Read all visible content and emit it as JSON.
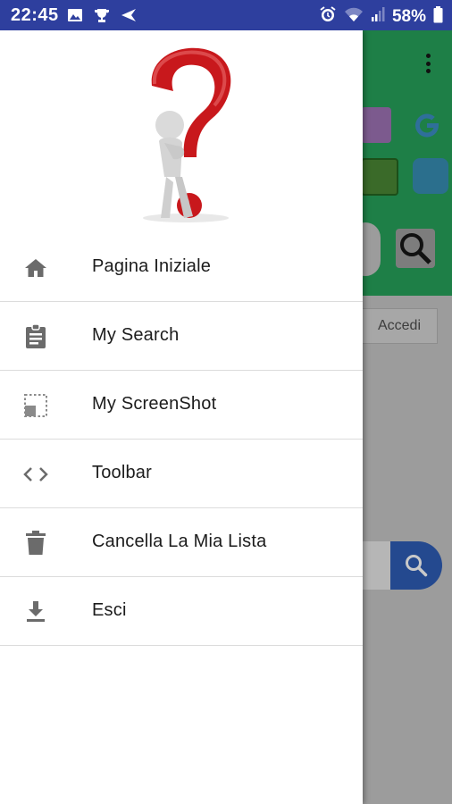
{
  "status_bar": {
    "time": "22:45",
    "battery": "58%",
    "left_icons": [
      "image-icon",
      "trophy-icon",
      "send-icon"
    ],
    "right_icons": [
      "alarm-icon",
      "wifi-icon",
      "signal-icon",
      "battery-icon"
    ]
  },
  "background_app": {
    "accent": "#1e7f47",
    "login_button": "Accedi",
    "icons": [
      "more-vert-icon",
      "app-tile-icon",
      "google-icon",
      "camera-icon",
      "refresh-icon",
      "search-icon"
    ]
  },
  "drawer": {
    "header_image": "question-mark-figure",
    "menu": [
      {
        "label": "Pagina Iniziale",
        "icon": "home-icon"
      },
      {
        "label": "My Search",
        "icon": "clipboard-icon"
      },
      {
        "label": "My ScreenShot",
        "icon": "screenshot-icon"
      },
      {
        "label": "Toolbar",
        "icon": "code-icon"
      },
      {
        "label": "Cancella La Mia Lista",
        "icon": "delete-icon"
      },
      {
        "label": "Esci",
        "icon": "download-icon"
      }
    ]
  }
}
